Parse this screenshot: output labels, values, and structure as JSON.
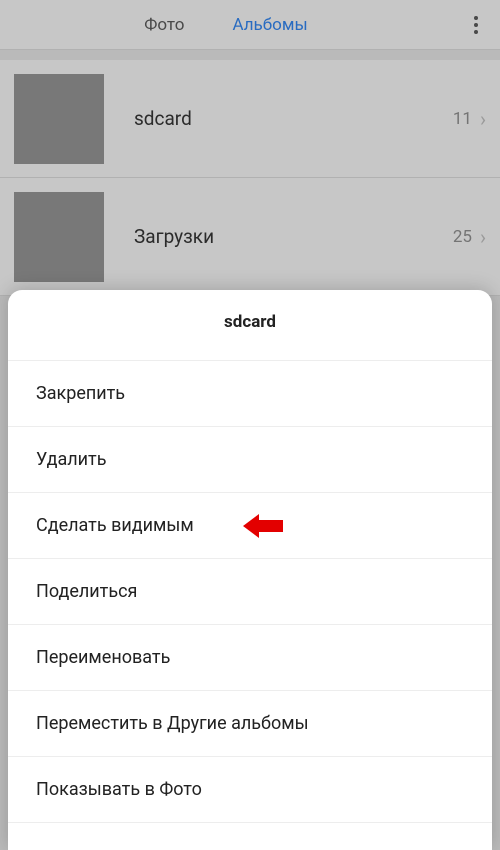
{
  "header": {
    "tab_photos": "Фото",
    "tab_albums": "Альбомы"
  },
  "albums": [
    {
      "title": "sdcard",
      "count": "11"
    },
    {
      "title": "Загрузки",
      "count": "25"
    }
  ],
  "sheet": {
    "title": "sdcard",
    "items": {
      "pin": "Закрепить",
      "delete": "Удалить",
      "make_visible": "Сделать видимым",
      "share": "Поделиться",
      "rename": "Переименовать",
      "move": "Переместить в Другие альбомы",
      "show_in_photos": "Показывать в Фото"
    }
  },
  "colors": {
    "accent": "#2f7de1",
    "callout": "#e30000"
  }
}
